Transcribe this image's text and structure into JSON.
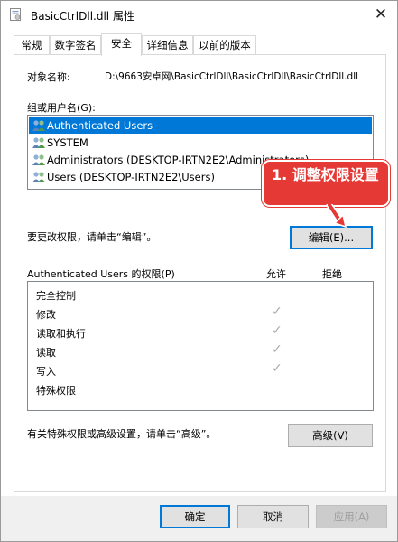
{
  "window": {
    "title": "BasicCtrlDll.dll 属性",
    "close_glyph": "✕"
  },
  "tabs": [
    {
      "label": "常规"
    },
    {
      "label": "数字签名"
    },
    {
      "label": "安全"
    },
    {
      "label": "详细信息"
    },
    {
      "label": "以前的版本"
    }
  ],
  "security": {
    "object_name_label": "对象名称:",
    "object_name_value": "D:\\9663安卓网\\BasicCtrlDll\\BasicCtrlDll\\BasicCtrlDll.dll",
    "group_label": "组或用户名(G):",
    "users": [
      {
        "name": "Authenticated Users",
        "selected": true
      },
      {
        "name": "SYSTEM",
        "selected": false
      },
      {
        "name": "Administrators (DESKTOP-IRTN2E2\\Administrators)",
        "selected": false
      },
      {
        "name": "Users (DESKTOP-IRTN2E2\\Users)",
        "selected": false
      }
    ],
    "change_hint": "要更改权限，请单击“编辑”。",
    "edit_button": "编辑(E)...",
    "perm_title": "Authenticated Users 的权限(P)",
    "allow_header": "允许",
    "deny_header": "拒绝",
    "permissions": [
      {
        "name": "完全控制",
        "allow": false
      },
      {
        "name": "修改",
        "allow": true
      },
      {
        "name": "读取和执行",
        "allow": true
      },
      {
        "name": "读取",
        "allow": true
      },
      {
        "name": "写入",
        "allow": true
      },
      {
        "name": "特殊权限",
        "allow": false
      }
    ],
    "check_glyph": "✓",
    "advanced_hint": "有关特殊权限或高级设置，请单击“高级”。",
    "advanced_button": "高级(V)"
  },
  "annotation": {
    "text": "1. 调整权限设置",
    "color": "#e53935"
  },
  "footer": {
    "ok_button": "确定",
    "cancel_button": "取消",
    "apply_button": "应用(A)"
  },
  "colors": {
    "selection": "#0078d7",
    "focus_border": "#0078d7"
  }
}
